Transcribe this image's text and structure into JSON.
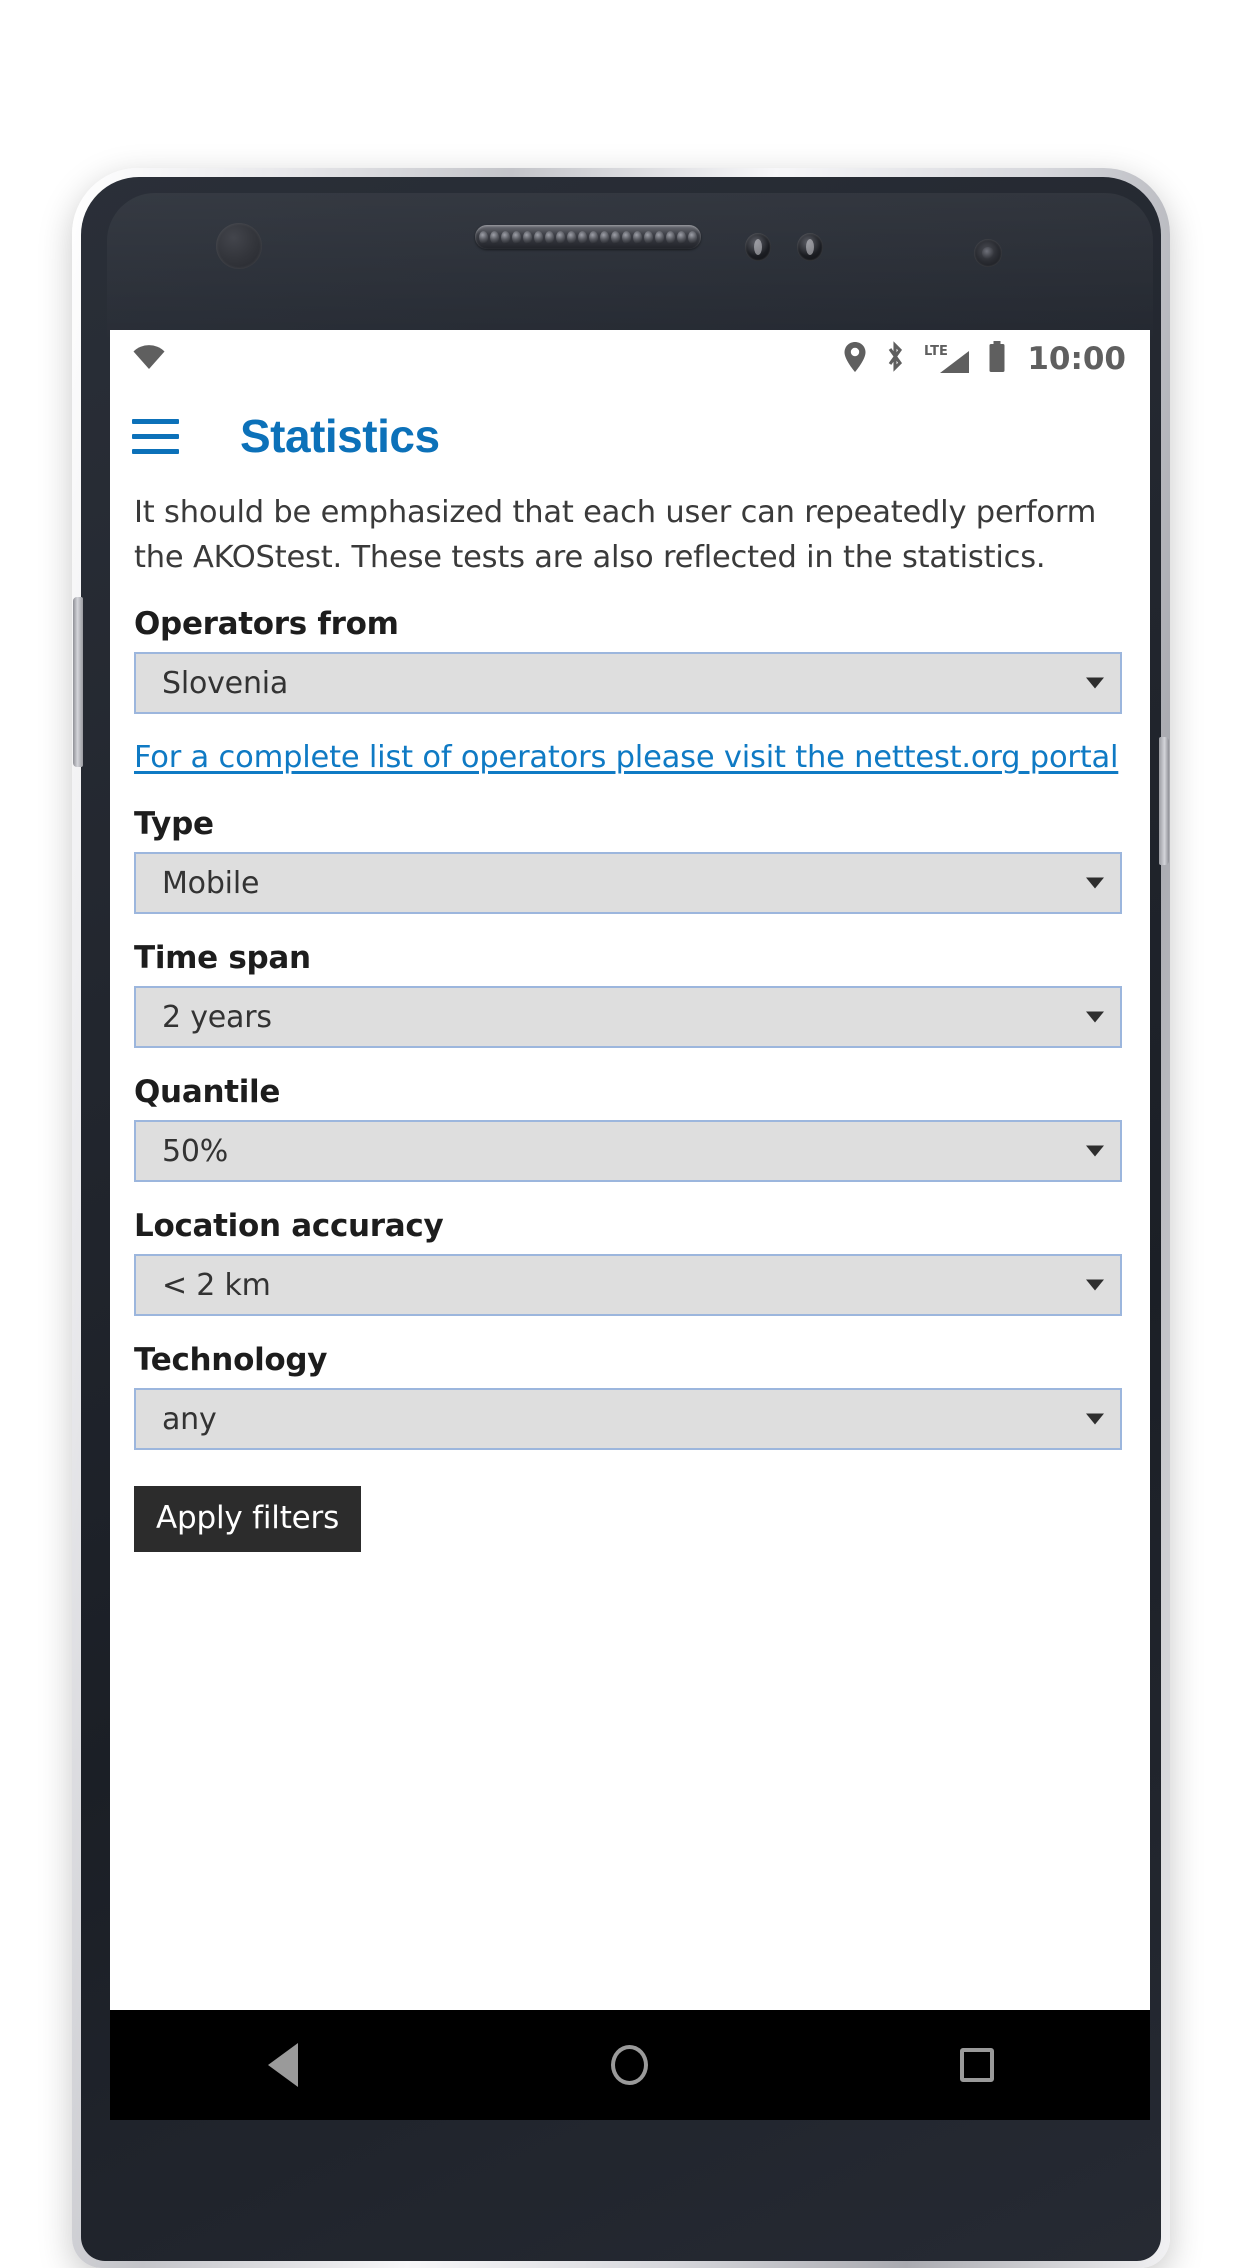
{
  "status_bar": {
    "wifi_icon": "wifi-icon",
    "location_icon": "location-pin-icon",
    "bluetooth_icon": "bluetooth-icon",
    "network_label": "LTE",
    "signal_icon": "signal-bars-icon",
    "battery_icon": "battery-icon",
    "clock": "10:00"
  },
  "header": {
    "menu_icon": "hamburger-menu-icon",
    "title": "Statistics",
    "accent_color": "#0c71b9"
  },
  "main": {
    "intro_text": "It should be emphasized that each user can repeatedly perform the AKOStest. These tests are also reflected in the statistics.",
    "portal_link": "For a complete list of operators please visit the nettest.org portal",
    "fields": [
      {
        "label": "Operators from",
        "value": "Slovenia"
      },
      {
        "label": "Type",
        "value": "Mobile"
      },
      {
        "label": "Time span",
        "value": "2 years"
      },
      {
        "label": "Quantile",
        "value": "50%"
      },
      {
        "label": "Location accuracy",
        "value": "< 2 km"
      },
      {
        "label": "Technology",
        "value": "any"
      }
    ],
    "apply_button": "Apply filters"
  },
  "nav_bar": {
    "back": "back-button",
    "home": "home-button",
    "recents": "recents-button"
  },
  "colors": {
    "accent": "#0c71b9",
    "link": "#0f7ac4",
    "select_fill": "#dedede",
    "select_border": "#9cb6dd",
    "button_bg": "#2c2c2c"
  }
}
